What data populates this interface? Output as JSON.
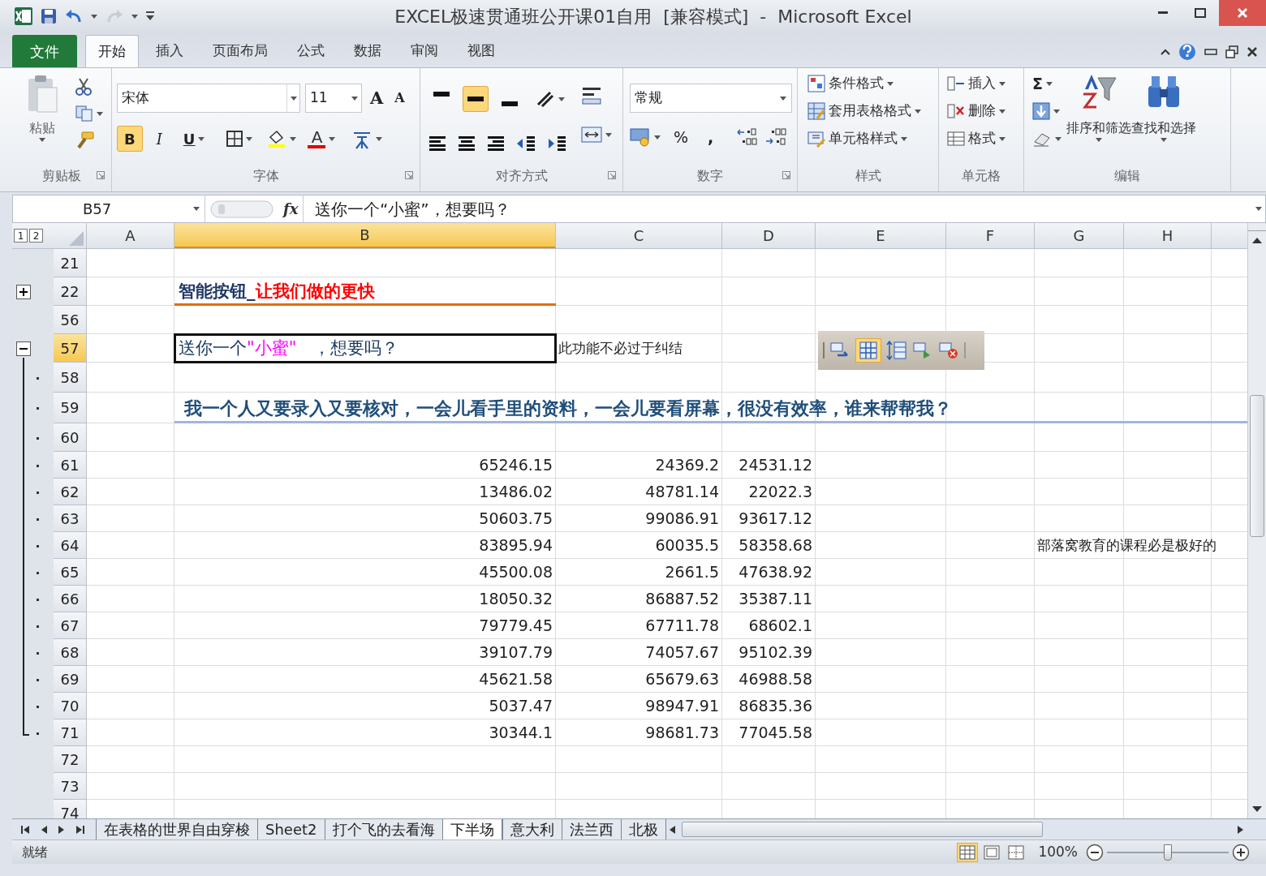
{
  "window": {
    "title": "EXCEL极速贯通班公开课01自用  [兼容模式]  -  Microsoft Excel"
  },
  "ribbon_tabs": [
    {
      "label": "文件",
      "kind": "file",
      "selected": false
    },
    {
      "label": "开始",
      "kind": "tab",
      "selected": true
    },
    {
      "label": "插入",
      "kind": "tab",
      "selected": false
    },
    {
      "label": "页面布局",
      "kind": "tab",
      "selected": false
    },
    {
      "label": "公式",
      "kind": "tab",
      "selected": false
    },
    {
      "label": "数据",
      "kind": "tab",
      "selected": false
    },
    {
      "label": "审阅",
      "kind": "tab",
      "selected": false
    },
    {
      "label": "视图",
      "kind": "tab",
      "selected": false
    }
  ],
  "clipboard": {
    "paste": "粘贴",
    "label": "剪贴板"
  },
  "font": {
    "name": "宋体",
    "size": "11",
    "grow": "A",
    "shrink": "A",
    "buttons": [
      {
        "label": "B",
        "kind": "bold",
        "selected": true
      },
      {
        "label": "I",
        "kind": "italic",
        "selected": false
      },
      {
        "label": "U",
        "kind": "underline",
        "selected": false
      }
    ],
    "font_color": "A",
    "label": "字体"
  },
  "alignment": {
    "vertical": [
      {
        "kind": "top",
        "selected": false
      },
      {
        "kind": "middle",
        "selected": true
      },
      {
        "kind": "bottom",
        "selected": false
      }
    ],
    "label": "对齐方式"
  },
  "number": {
    "format": "常规",
    "percent": "%",
    "comma": ",",
    "label": "数字"
  },
  "styles": {
    "items": [
      "条件格式",
      "套用表格格式",
      "单元格样式"
    ],
    "label": "样式"
  },
  "cells": {
    "items": [
      "插入",
      "删除",
      "格式"
    ],
    "label": "单元格"
  },
  "editing": {
    "sum": "Σ",
    "items": [
      "排序和筛选",
      "查找和选择"
    ],
    "label": "编辑"
  },
  "formula_bar": {
    "name_box": "B57",
    "fx": "fx",
    "formula": "送你一个“小蜜”，想要吗？"
  },
  "outline_levels": [
    "1",
    "2"
  ],
  "columns": [
    {
      "label": "A",
      "selected": false
    },
    {
      "label": "B",
      "selected": true
    },
    {
      "label": "C",
      "selected": false
    },
    {
      "label": "D",
      "selected": false
    },
    {
      "label": "E",
      "selected": false
    },
    {
      "label": "F",
      "selected": false
    },
    {
      "label": "G",
      "selected": false
    },
    {
      "label": "H",
      "selected": false
    }
  ],
  "rows": [
    {
      "number": "21",
      "selected": false,
      "cells": {}
    },
    {
      "number": "22",
      "selected": false,
      "outline": {
        "kind": "plus"
      },
      "cells": {
        "b": {
          "kind": "title",
          "parts": [
            {
              "text": "智能按钮_",
              "color": "#1f3864"
            },
            {
              "text": "让我们做的更快",
              "color": "#ff0000"
            }
          ]
        }
      }
    },
    {
      "number": "56",
      "selected": false,
      "cells": {}
    },
    {
      "number": "57",
      "selected": true,
      "outline": {
        "kind": "minus"
      },
      "cells": {
        "b": {
          "kind": "input",
          "active": true,
          "parts": [
            {
              "text": "送你一个",
              "color": "#17365d"
            },
            {
              "text": "\"小蜜\"",
              "color": "#ff00ff"
            },
            {
              "text": "　，想要吗？",
              "color": "#17365d"
            }
          ]
        },
        "c": {
          "kind": "note",
          "text": "此功能不必过于纠结"
        }
      }
    },
    {
      "number": "58",
      "selected": false,
      "outline": {
        "kind": "dot"
      },
      "cells": {}
    },
    {
      "number": "59",
      "selected": false,
      "outline": {
        "kind": "dot"
      },
      "cells": {
        "b": {
          "kind": "heading",
          "text": "我一个人又要录入又要核对，一会儿看手里的资料，一会儿要看屏幕，很没有效率，谁来帮帮我？"
        }
      }
    },
    {
      "number": "60",
      "selected": false,
      "outline": {
        "kind": "dot"
      },
      "cells": {}
    },
    {
      "number": "61",
      "selected": false,
      "outline": {
        "kind": "dot"
      },
      "cells": {
        "b": {
          "kind": "number",
          "text": "65246.15"
        },
        "c": {
          "kind": "number",
          "text": "24369.2"
        },
        "d": {
          "kind": "number",
          "text": "24531.12"
        }
      }
    },
    {
      "number": "62",
      "selected": false,
      "outline": {
        "kind": "dot"
      },
      "cells": {
        "b": {
          "kind": "number",
          "text": "13486.02"
        },
        "c": {
          "kind": "number",
          "text": "48781.14"
        },
        "d": {
          "kind": "number",
          "text": "22022.3"
        }
      }
    },
    {
      "number": "63",
      "selected": false,
      "outline": {
        "kind": "dot"
      },
      "cells": {
        "b": {
          "kind": "number",
          "text": "50603.75"
        },
        "c": {
          "kind": "number",
          "text": "99086.91"
        },
        "d": {
          "kind": "number",
          "text": "93617.12"
        }
      }
    },
    {
      "number": "64",
      "selected": false,
      "outline": {
        "kind": "dot"
      },
      "cells": {
        "b": {
          "kind": "number",
          "text": "83895.94"
        },
        "c": {
          "kind": "number",
          "text": "60035.5"
        },
        "d": {
          "kind": "number",
          "text": "58358.68"
        },
        "g": {
          "kind": "note",
          "text": "部落窝教育的课程必是极好的"
        }
      }
    },
    {
      "number": "65",
      "selected": false,
      "outline": {
        "kind": "dot"
      },
      "cells": {
        "b": {
          "kind": "number",
          "text": "45500.08"
        },
        "c": {
          "kind": "number",
          "text": "2661.5"
        },
        "d": {
          "kind": "number",
          "text": "47638.92"
        }
      }
    },
    {
      "number": "66",
      "selected": false,
      "outline": {
        "kind": "dot"
      },
      "cells": {
        "b": {
          "kind": "number",
          "text": "18050.32"
        },
        "c": {
          "kind": "number",
          "text": "86887.52"
        },
        "d": {
          "kind": "number",
          "text": "35387.11"
        }
      }
    },
    {
      "number": "67",
      "selected": false,
      "outline": {
        "kind": "dot"
      },
      "cells": {
        "b": {
          "kind": "number",
          "text": "79779.45"
        },
        "c": {
          "kind": "number",
          "text": "67711.78"
        },
        "d": {
          "kind": "number",
          "text": "68602.1"
        }
      }
    },
    {
      "number": "68",
      "selected": false,
      "outline": {
        "kind": "dot"
      },
      "cells": {
        "b": {
          "kind": "number",
          "text": "39107.79"
        },
        "c": {
          "kind": "number",
          "text": "74057.67"
        },
        "d": {
          "kind": "number",
          "text": "95102.39"
        }
      }
    },
    {
      "number": "69",
      "selected": false,
      "outline": {
        "kind": "dot"
      },
      "cells": {
        "b": {
          "kind": "number",
          "text": "45621.58"
        },
        "c": {
          "kind": "number",
          "text": "65679.63"
        },
        "d": {
          "kind": "number",
          "text": "46988.58"
        }
      }
    },
    {
      "number": "70",
      "selected": false,
      "outline": {
        "kind": "dot"
      },
      "cells": {
        "b": {
          "kind": "number",
          "text": "5037.47"
        },
        "c": {
          "kind": "number",
          "text": "98947.91"
        },
        "d": {
          "kind": "number",
          "text": "86835.36"
        }
      }
    },
    {
      "number": "71",
      "selected": false,
      "outline": {
        "kind": "end"
      },
      "cells": {
        "b": {
          "kind": "number",
          "text": "30344.1"
        },
        "c": {
          "kind": "number",
          "text": "98681.73"
        },
        "d": {
          "kind": "number",
          "text": "77045.58"
        }
      }
    },
    {
      "number": "72",
      "selected": false,
      "cells": {}
    },
    {
      "number": "73",
      "selected": false,
      "cells": {}
    },
    {
      "number": "74",
      "selected": false,
      "cells": {}
    }
  ],
  "sheet_tabs": [
    {
      "label": "在表格的世界自由穿梭",
      "selected": false
    },
    {
      "label": "Sheet2",
      "selected": false
    },
    {
      "label": "打个飞的去看海",
      "selected": false
    },
    {
      "label": "下半场",
      "selected": true
    },
    {
      "label": "意大利",
      "selected": false
    },
    {
      "label": "法兰西",
      "selected": false
    },
    {
      "label": "北极",
      "selected": false
    }
  ],
  "status_bar": {
    "status": "就绪",
    "views": [
      {
        "kind": "normal",
        "selected": true
      },
      {
        "kind": "layout",
        "selected": false
      },
      {
        "kind": "break",
        "selected": false
      }
    ],
    "zoom": "100%",
    "zoom_slider": {
      "level": 0.5
    }
  }
}
